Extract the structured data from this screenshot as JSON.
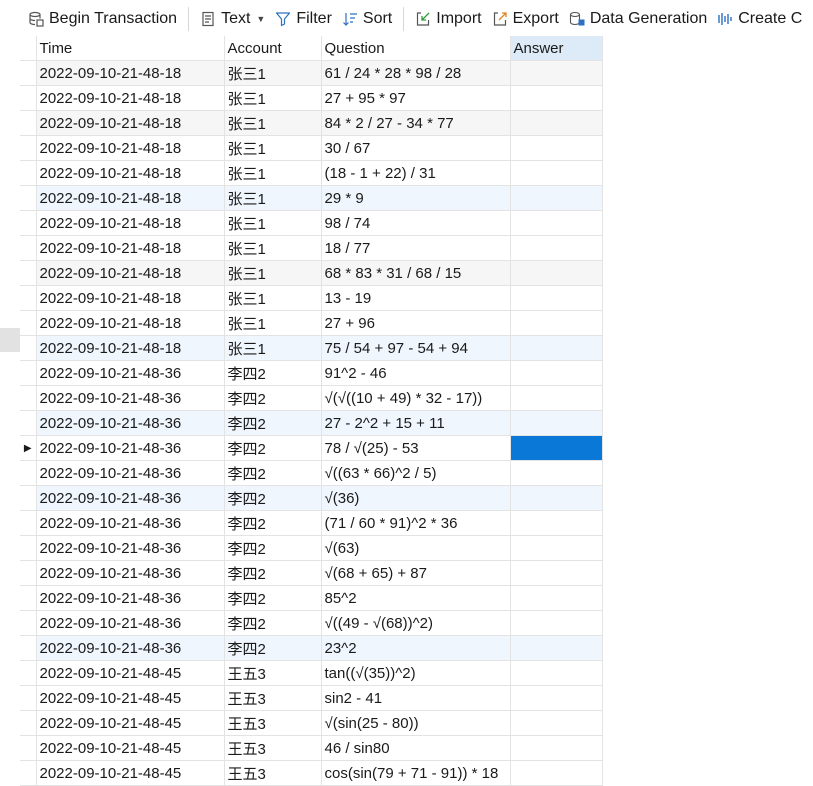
{
  "toolbar": {
    "begin_transaction": "Begin Transaction",
    "text": "Text",
    "filter": "Filter",
    "sort": "Sort",
    "import": "Import",
    "export": "Export",
    "data_generation": "Data Generation",
    "create": "Create C"
  },
  "columns": [
    "Time",
    "Account",
    "Question",
    "Answer"
  ],
  "rows": [
    {
      "time": "2022-09-10-21-48-18",
      "account": "张三1",
      "question": "61 / 24 * 28 * 98 / 28",
      "answer": ""
    },
    {
      "time": "2022-09-10-21-48-18",
      "account": "张三1",
      "question": "27 + 95 * 97",
      "answer": ""
    },
    {
      "time": "2022-09-10-21-48-18",
      "account": "张三1",
      "question": "84 * 2 / 27 - 34 * 77",
      "answer": ""
    },
    {
      "time": "2022-09-10-21-48-18",
      "account": "张三1",
      "question": "30 / 67",
      "answer": ""
    },
    {
      "time": "2022-09-10-21-48-18",
      "account": "张三1",
      "question": "(18 - 1 + 22) / 31",
      "answer": ""
    },
    {
      "time": "2022-09-10-21-48-18",
      "account": "张三1",
      "question": "29 * 9",
      "answer": ""
    },
    {
      "time": "2022-09-10-21-48-18",
      "account": "张三1",
      "question": "98 / 74",
      "answer": ""
    },
    {
      "time": "2022-09-10-21-48-18",
      "account": "张三1",
      "question": "18 / 77",
      "answer": ""
    },
    {
      "time": "2022-09-10-21-48-18",
      "account": "张三1",
      "question": "68 * 83 * 31 / 68 / 15",
      "answer": ""
    },
    {
      "time": "2022-09-10-21-48-18",
      "account": "张三1",
      "question": "13 - 19",
      "answer": ""
    },
    {
      "time": "2022-09-10-21-48-18",
      "account": "张三1",
      "question": "27 + 96",
      "answer": ""
    },
    {
      "time": "2022-09-10-21-48-18",
      "account": "张三1",
      "question": "75 / 54 + 97 - 54 + 94",
      "answer": ""
    },
    {
      "time": "2022-09-10-21-48-36",
      "account": "李四2",
      "question": "91^2 - 46",
      "answer": ""
    },
    {
      "time": "2022-09-10-21-48-36",
      "account": "李四2",
      "question": "√(√((10 + 49) * 32 - 17))",
      "answer": ""
    },
    {
      "time": "2022-09-10-21-48-36",
      "account": "李四2",
      "question": "27 - 2^2 + 15 + 11",
      "answer": ""
    },
    {
      "time": "2022-09-10-21-48-36",
      "account": "李四2",
      "question": "78 / √(25) - 53",
      "answer": ""
    },
    {
      "time": "2022-09-10-21-48-36",
      "account": "李四2",
      "question": "√((63 * 66)^2 / 5)",
      "answer": ""
    },
    {
      "time": "2022-09-10-21-48-36",
      "account": "李四2",
      "question": "√(36)",
      "answer": ""
    },
    {
      "time": "2022-09-10-21-48-36",
      "account": "李四2",
      "question": "(71 / 60 * 91)^2 * 36",
      "answer": ""
    },
    {
      "time": "2022-09-10-21-48-36",
      "account": "李四2",
      "question": "√(63)",
      "answer": ""
    },
    {
      "time": "2022-09-10-21-48-36",
      "account": "李四2",
      "question": "√(68 + 65) + 87",
      "answer": ""
    },
    {
      "time": "2022-09-10-21-48-36",
      "account": "李四2",
      "question": "85^2",
      "answer": ""
    },
    {
      "time": "2022-09-10-21-48-36",
      "account": "李四2",
      "question": "√((49 - √(68))^2)",
      "answer": ""
    },
    {
      "time": "2022-09-10-21-48-36",
      "account": "李四2",
      "question": "23^2",
      "answer": ""
    },
    {
      "time": "2022-09-10-21-48-45",
      "account": "王五3",
      "question": "tan((√(35))^2)",
      "answer": ""
    },
    {
      "time": "2022-09-10-21-48-45",
      "account": "王五3",
      "question": "sin2 - 41",
      "answer": ""
    },
    {
      "time": "2022-09-10-21-48-45",
      "account": "王五3",
      "question": "√(sin(25 - 80))",
      "answer": ""
    },
    {
      "time": "2022-09-10-21-48-45",
      "account": "王五3",
      "question": "46 / sin80",
      "answer": ""
    },
    {
      "time": "2022-09-10-21-48-45",
      "account": "王五3",
      "question": "cos(sin(79 + 71 - 91)) * 18",
      "answer": ""
    }
  ],
  "selected_row": 15,
  "colors": {
    "selection": "#0a78d7",
    "header_answer": "#ddeaf7",
    "row_alt": "#f6f6f6",
    "row_highlight": "#f0f6fd",
    "grid_line": "#e3e3e3"
  },
  "icons": {
    "begin_transaction": "database-transaction-icon",
    "text": "text-document-icon",
    "filter": "filter-funnel-icon",
    "sort": "sort-icon",
    "import": "import-icon",
    "export": "export-icon",
    "data_generation": "data-generation-icon",
    "create": "create-chart-icon",
    "row_indicator": "row-pointer-icon"
  }
}
